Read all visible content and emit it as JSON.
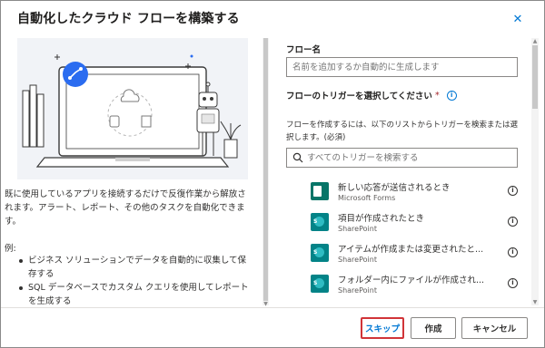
{
  "dialog": {
    "title": "自動化したクラウド フローを構築する",
    "close_label": "✕"
  },
  "left": {
    "description": "既に使用しているアプリを接続するだけで反復作業から解放されます。アラート、レポート、その他のタスクを自動化できます。",
    "example_label": "例:",
    "examples": [
      "ビジネス ソリューションでデータを自動的に収集して保存する",
      "SQL データベースでカスタム クエリを使用してレポートを生成する"
    ]
  },
  "right": {
    "flow_name_label": "フロー名",
    "flow_name_placeholder": "名前を追加するか自動的に生成します",
    "trigger_label": "フローのトリガーを選択してください",
    "required_mark": "*",
    "trigger_help": "フローを作成するには、以下のリストからトリガーを検索または選択します。(必須)",
    "search_placeholder": "すべてのトリガーを検索する",
    "triggers": [
      {
        "title": "新しい応答が送信されるとき",
        "connector": "Microsoft Forms",
        "icon": "forms-icon"
      },
      {
        "title": "項目が作成されたとき",
        "connector": "SharePoint",
        "icon": "sharepoint-icon"
      },
      {
        "title": "アイテムが作成または変更されたと...",
        "connector": "SharePoint",
        "icon": "sharepoint-icon"
      },
      {
        "title": "フォルダー内にファイルが作成され...",
        "connector": "SharePoint",
        "icon": "sharepoint-icon"
      }
    ]
  },
  "footer": {
    "skip_label": "スキップ",
    "create_label": "作成",
    "cancel_label": "キャンセル"
  },
  "colors": {
    "accent": "#0078d4",
    "skip_highlight": "#d13438",
    "forms": "#077568",
    "sharepoint": "#038387"
  }
}
